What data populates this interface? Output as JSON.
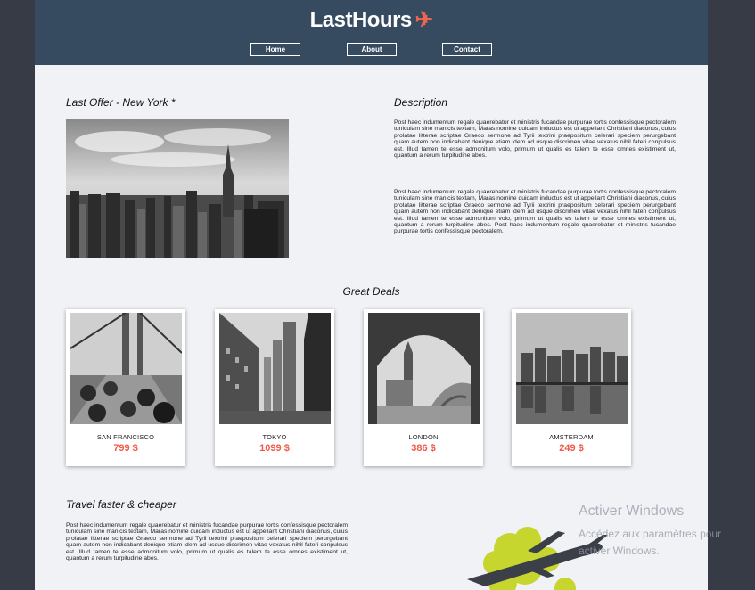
{
  "header": {
    "logo": "LastHours",
    "nav": [
      "Home",
      "About",
      "Contact"
    ]
  },
  "offer": {
    "title": "Last Offer - New York *"
  },
  "description": {
    "title": "Description",
    "p1": "Post haec indumentum regale quaerebatur et ministris fucandae purpurae tortis confessisque pectoralem tuniculam sine manicis textam, Maras nomine quidam inductus est ut appellant Christiani diaconus, cuius prolatae litterae scriptae Graeco sermone ad Tyrii textrini praepositum celerari speciem perurgebant quam autem non indicabant denique etiam idem ad usque discrimen vitae vexatus nihil fateri conpulsus est. Illud tamen te esse admonitum volo, primum ut qualis es talem te esse omnes existiment ut, quantum a rerum turpitudine abes.",
    "p2": "Post haec indumentum regale quaerebatur et ministris fucandae purpurae tortis confessisque pectoralem tuniculam sine manicis textam, Maras nomine quidam inductus est ut appellant Christiani diaconus, cuius prolatae litterae scriptae Graeco sermone ad Tyrii textrini praepositum celerari speciem perurgebant quam autem non indicabant denique etiam idem ad usque discrimen vitae vexatus nihil fateri conpulsus est. Illud tamen te esse admonitum volo, primum ut qualis es talem te esse omnes existiment ut, quantum a rerum turpitudine abes. Post haec indumentum regale quaerebatur et ministris fucandae purpurae tortis confessisque pectoralem."
  },
  "deals": {
    "title": "Great Deals",
    "items": [
      {
        "city": "SAN FRANCISCO",
        "price": "799 $"
      },
      {
        "city": "TOKYO",
        "price": "1099 $"
      },
      {
        "city": "LONDON",
        "price": "386 $"
      },
      {
        "city": "AMSTERDAM",
        "price": "249 $"
      }
    ]
  },
  "travel": {
    "title": "Travel faster & cheaper",
    "p": "Post haec indumentum regale quaerebatur et ministris fucandae purpurae tortis confessisque pectoralem tuniculam sine manicis textam, Maras nomine quidam inductus est ut appellant Christiani diaconus, cuius prolatae litterae scriptae Graeco sermone ad Tyrii textrini praepositum celerari speciem perurgebant quam autem non indicabant denique etiam idem ad usque discrimen vitae vexatus nihil fateri conpulsus est. Illud tamen te esse admonitum volo, primum ut qualis es talem te esse omnes existiment ut, quantum a rerum turpitudine abes."
  },
  "watermark": {
    "line1": "Activer Windows",
    "line2": "Accédez aux paramètres pour activer Windows."
  },
  "colors": {
    "header_bg": "#364a60",
    "accent": "#f05a4a",
    "page_bg": "#f0f2f6"
  }
}
